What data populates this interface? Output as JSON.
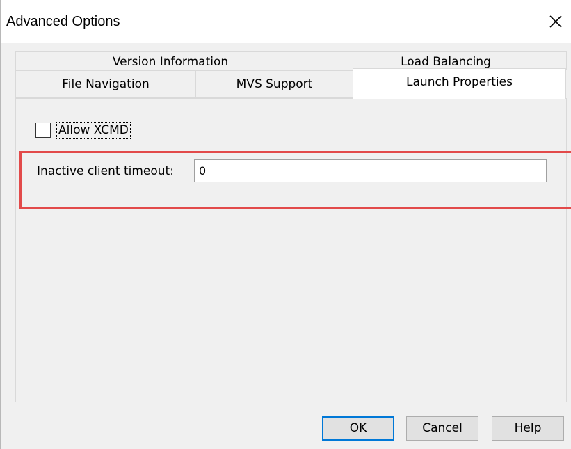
{
  "dialog": {
    "title": "Advanced Options",
    "close_icon": "close-icon"
  },
  "tabs": {
    "row1": [
      {
        "label": "Version Information"
      },
      {
        "label": "Load Balancing"
      }
    ],
    "row2": [
      {
        "label": "File Navigation"
      },
      {
        "label": "MVS Support"
      },
      {
        "label": "Launch Properties",
        "active": true
      }
    ]
  },
  "launch_properties": {
    "allow_xcmd": {
      "label": "Allow XCMD",
      "checked": false
    },
    "inactive_timeout": {
      "label": "Inactive client timeout:",
      "value": "0"
    }
  },
  "buttons": {
    "ok": "OK",
    "cancel": "Cancel",
    "help": "Help"
  },
  "colors": {
    "highlight": "#e24a4a",
    "focus": "#0078d7"
  }
}
